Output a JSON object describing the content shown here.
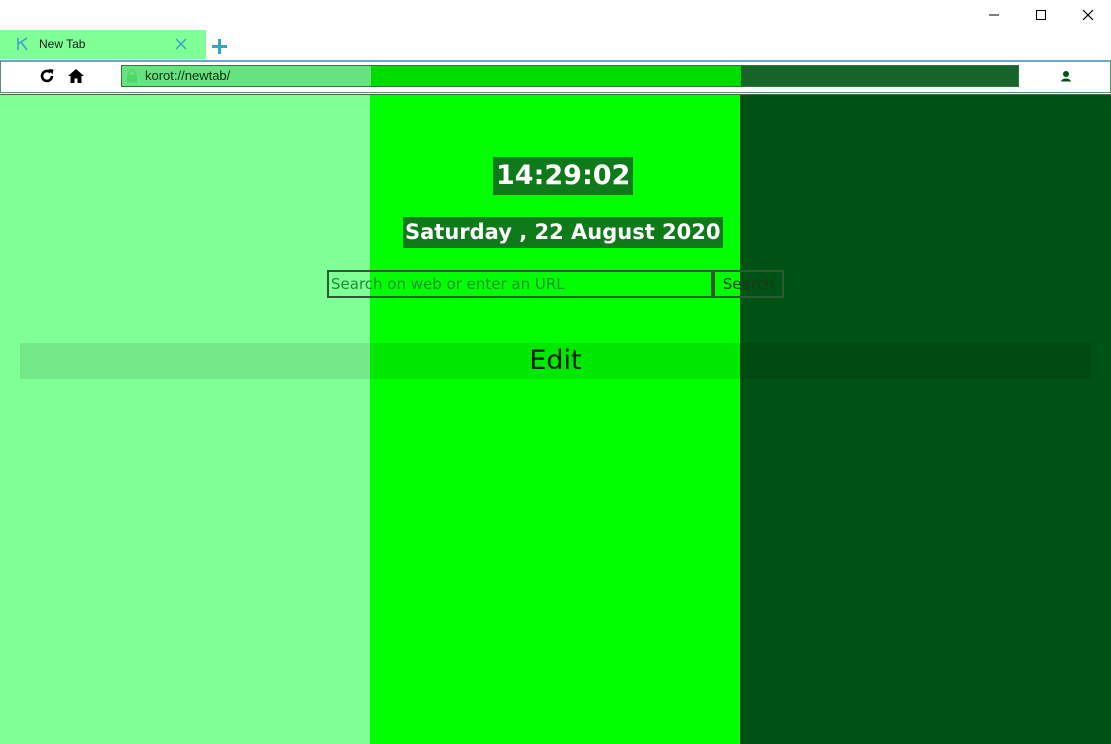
{
  "window": {
    "minimize_icon": "minimize-icon",
    "maximize_icon": "maximize-icon",
    "close_icon": "close-icon"
  },
  "tab": {
    "title": "New Tab",
    "favicon": "korot-logo-icon",
    "close_icon": "close-icon"
  },
  "new_tab_icon": "plus-icon",
  "toolbar": {
    "refresh_icon": "refresh-icon",
    "home_icon": "home-icon",
    "lock_icon": "lock-icon",
    "url": "korot://newtab/",
    "favorites_icon": "heart-icon",
    "profile_icon": "user-icon",
    "menu_icon": "hamburger-menu-icon"
  },
  "newtab": {
    "time": "14:29:02",
    "date": "Saturday , 22 August 2020",
    "search_placeholder": "Search on web or enter an URL",
    "search_button": "Search",
    "edit_label": "Edit"
  },
  "colors": {
    "band_left": "#80ff96",
    "band_middle": "#00ff00",
    "band_right": "#005214",
    "tab_background": "#80ff96",
    "accent_blue": "#39a3c7"
  }
}
